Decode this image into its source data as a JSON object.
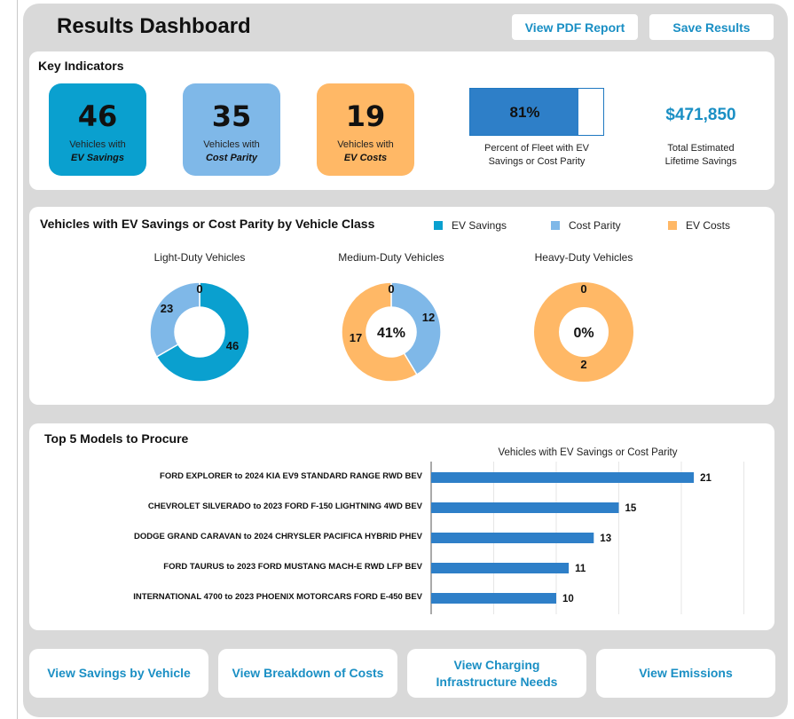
{
  "header": {
    "title": "Results Dashboard",
    "pdf_button": "View PDF Report",
    "save_button": "Save Results"
  },
  "key_indicators": {
    "title": "Key Indicators",
    "ev_savings": {
      "count": "46",
      "line1": "Vehicles with",
      "line2": "EV Savings",
      "color": "#0aa0cf"
    },
    "cost_parity": {
      "count": "35",
      "line1": "Vehicles with",
      "line2": "Cost Parity",
      "color": "#7fb8e8"
    },
    "ev_costs": {
      "count": "19",
      "line1": "Vehicles with",
      "line2": "EV Costs",
      "color": "#ffb866"
    },
    "fleet_percent": {
      "label": "81%",
      "fraction": 0.81,
      "caption_line1": "Percent of Fleet with EV",
      "caption_line2": "Savings or Cost Parity"
    },
    "lifetime_savings": {
      "value": "$471,850",
      "caption_line1": "Total Estimated",
      "caption_line2": "Lifetime Savings"
    }
  },
  "class_section": {
    "title": "Vehicles with EV Savings or Cost Parity by Vehicle Class",
    "legend": {
      "ev_savings": "EV Savings",
      "cost_parity": "Cost Parity",
      "ev_costs": "EV Costs"
    }
  },
  "top_models": {
    "title": "Top 5 Models to Procure"
  },
  "chart_data": [
    {
      "type": "pie",
      "variant": "donut",
      "title": "Light-Duty Vehicles",
      "center_label": "",
      "slices": [
        {
          "name": "EV Savings",
          "value": 46,
          "color": "#0aa0cf"
        },
        {
          "name": "Cost Parity",
          "value": 23,
          "color": "#7fb8e8"
        },
        {
          "name": "EV Costs",
          "value": 0,
          "color": "#ffb866"
        }
      ]
    },
    {
      "type": "pie",
      "variant": "donut",
      "title": "Medium-Duty Vehicles",
      "center_label": "41%",
      "slices": [
        {
          "name": "EV Savings",
          "value": 0,
          "color": "#0aa0cf"
        },
        {
          "name": "Cost Parity",
          "value": 12,
          "color": "#7fb8e8"
        },
        {
          "name": "EV Costs",
          "value": 17,
          "color": "#ffb866"
        }
      ]
    },
    {
      "type": "pie",
      "variant": "donut",
      "title": "Heavy-Duty Vehicles",
      "center_label": "0%",
      "slices": [
        {
          "name": "EV Savings",
          "value": 0,
          "color": "#0aa0cf"
        },
        {
          "name": "Cost Parity",
          "value": 0,
          "color": "#7fb8e8"
        },
        {
          "name": "EV Costs",
          "value": 2,
          "color": "#ffb866"
        }
      ]
    },
    {
      "type": "bar",
      "orientation": "horizontal",
      "title": "Vehicles with EV Savings or Cost Parity",
      "categories": [
        "FORD EXPLORER to 2024 KIA EV9 STANDARD RANGE RWD BEV",
        "CHEVROLET SILVERADO to 2023 FORD F-150 LIGHTNING 4WD BEV",
        "DODGE GRAND CARAVAN to 2024 CHRYSLER PACIFICA HYBRID PHEV",
        "FORD TAURUS to 2023 FORD MUSTANG MACH-E RWD LFP BEV",
        "INTERNATIONAL 4700 to 2023 PHOENIX MOTORCARS FORD E-450 BEV"
      ],
      "values": [
        21,
        15,
        13,
        11,
        10
      ],
      "color": "#2e7fc8",
      "xlim": [
        0,
        25
      ],
      "grid": true
    }
  ],
  "footer": {
    "savings_by_vehicle": "View Savings by Vehicle",
    "breakdown_of_costs": "View Breakdown of Costs",
    "charging_line1": "View Charging",
    "charging_line2": "Infrastructure Needs",
    "emissions": "View Emissions"
  }
}
